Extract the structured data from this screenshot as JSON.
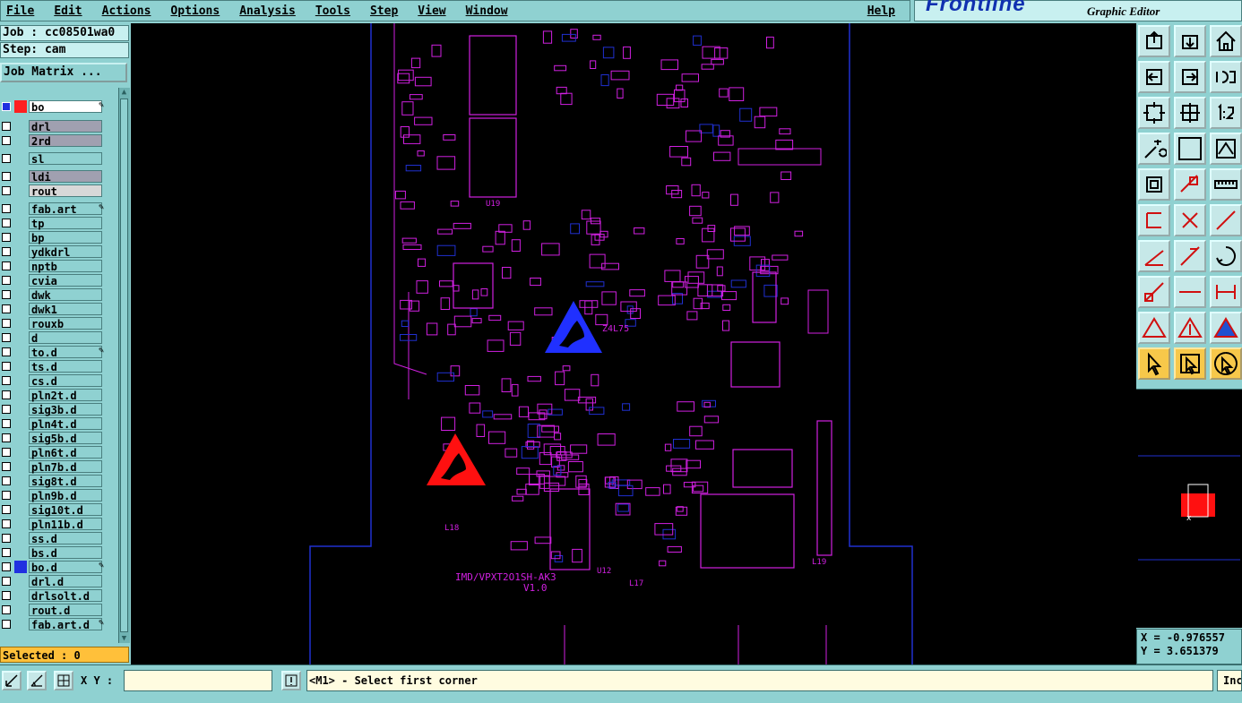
{
  "menubar": {
    "items": [
      "File",
      "Edit",
      "Actions",
      "Options",
      "Analysis",
      "Tools",
      "Step",
      "View",
      "Window"
    ],
    "help": "Help"
  },
  "brand": {
    "logo": "Frontline",
    "subtitle": "Graphic Editor"
  },
  "left_panel": {
    "job": "Job : cc08501wa0",
    "step": "Step: cam",
    "job_matrix": "Job Matrix ...",
    "selected": "Selected : 0",
    "layers": [
      {
        "name": "bo",
        "color": "#ff2020",
        "active": true,
        "editable": true
      },
      {
        "name": "drl",
        "color": "#8fd1d1",
        "bg": "#a0a0b0"
      },
      {
        "name": "2rd",
        "color": "#8fd1d1",
        "bg": "#a0a0b0"
      },
      {
        "name": "sl",
        "color": "#8fd1d1"
      },
      {
        "name": "ldi",
        "color": "#8fd1d1",
        "bg": "#a0a0b0"
      },
      {
        "name": "rout",
        "color": "#8fd1d1",
        "bg": "#d8d8d8"
      },
      {
        "name": "fab.art",
        "color": "#8fd1d1",
        "editable": true
      },
      {
        "name": "tp",
        "color": "#8fd1d1"
      },
      {
        "name": "bp",
        "color": "#8fd1d1"
      },
      {
        "name": "ydkdrl",
        "color": "#8fd1d1"
      },
      {
        "name": "nptb",
        "color": "#8fd1d1"
      },
      {
        "name": "cvia",
        "color": "#8fd1d1"
      },
      {
        "name": "dwk",
        "color": "#8fd1d1"
      },
      {
        "name": "dwk1",
        "color": "#8fd1d1"
      },
      {
        "name": "rouxb",
        "color": "#8fd1d1"
      },
      {
        "name": "d",
        "color": "#8fd1d1"
      },
      {
        "name": "to.d",
        "color": "#8fd1d1",
        "editable": true
      },
      {
        "name": "ts.d",
        "color": "#8fd1d1"
      },
      {
        "name": "cs.d",
        "color": "#8fd1d1"
      },
      {
        "name": "pln2t.d",
        "color": "#8fd1d1"
      },
      {
        "name": "sig3b.d",
        "color": "#8fd1d1"
      },
      {
        "name": "pln4t.d",
        "color": "#8fd1d1"
      },
      {
        "name": "sig5b.d",
        "color": "#8fd1d1"
      },
      {
        "name": "pln6t.d",
        "color": "#8fd1d1"
      },
      {
        "name": "pln7b.d",
        "color": "#8fd1d1"
      },
      {
        "name": "sig8t.d",
        "color": "#8fd1d1"
      },
      {
        "name": "pln9b.d",
        "color": "#8fd1d1"
      },
      {
        "name": "sig10t.d",
        "color": "#8fd1d1"
      },
      {
        "name": "pln11b.d",
        "color": "#8fd1d1"
      },
      {
        "name": "ss.d",
        "color": "#8fd1d1"
      },
      {
        "name": "bs.d",
        "color": "#8fd1d1"
      },
      {
        "name": "bo.d",
        "color": "#2030e0",
        "editable": true
      },
      {
        "name": "drl.d",
        "color": "#8fd1d1"
      },
      {
        "name": "drlsolt.d",
        "color": "#8fd1d1"
      },
      {
        "name": "rout.d",
        "color": "#8fd1d1"
      },
      {
        "name": "fab.art.d",
        "color": "#8fd1d1",
        "editable": true
      }
    ]
  },
  "canvas": {
    "board_texts": [
      "U19",
      "U12",
      "L17",
      "L18",
      "L19",
      "V1.0",
      "Z4L75",
      "IMD/VPXT2O1SH-AK3"
    ]
  },
  "right_panel": {
    "coord_x": "X = -0.976557",
    "coord_y": "Y = 3.651379"
  },
  "bottom": {
    "xy_label": "X Y :",
    "xy_value": "",
    "message": "<M1> - Select first corner",
    "indicator": "Inc"
  },
  "colors": {
    "panel": "#8fd1d1",
    "board_outline": "#2030d0",
    "component": "#d020e0",
    "accent_orange": "#f7c84a",
    "esd_red": "#ff1010",
    "esd_blue": "#2030ff"
  }
}
